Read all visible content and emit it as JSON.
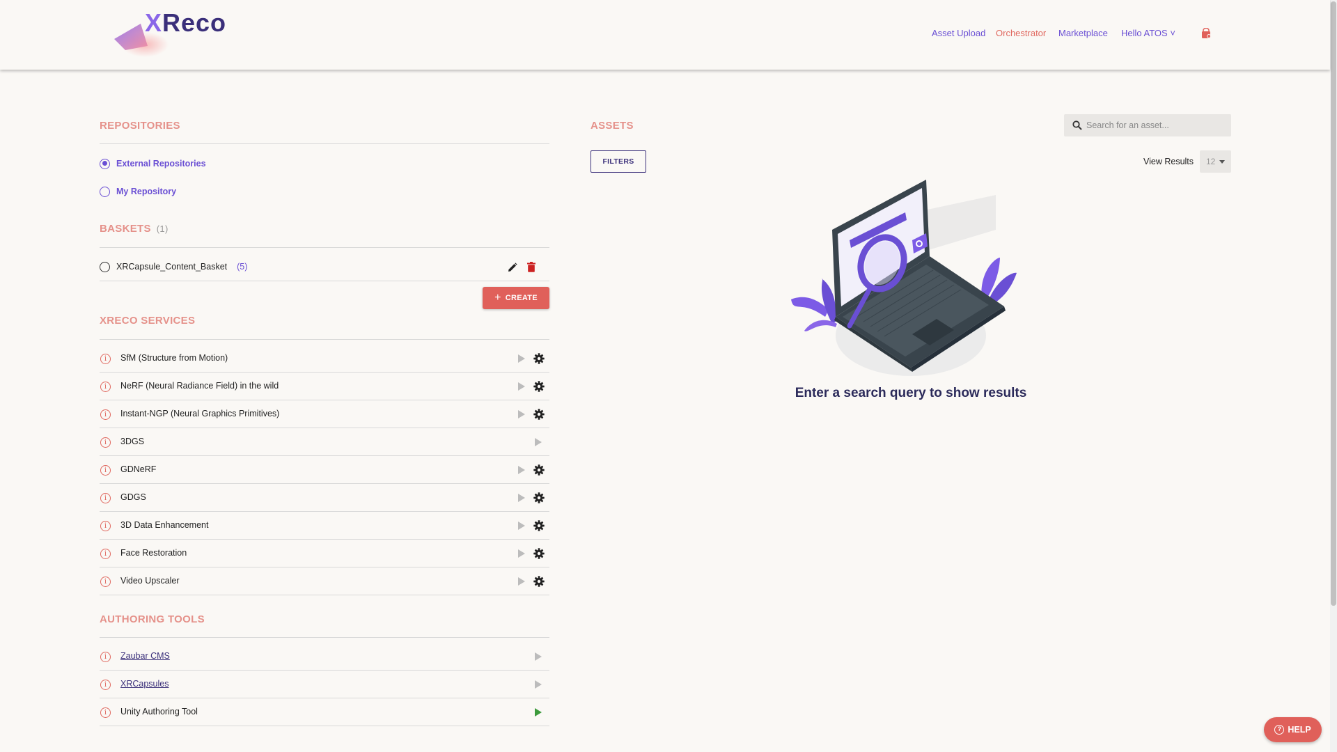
{
  "header": {
    "logo_text_x": "X",
    "logo_text_rest": "Reco",
    "nav": [
      {
        "label": "Asset Upload",
        "active": false
      },
      {
        "label": "Orchestrator",
        "active": true
      },
      {
        "label": "Marketplace",
        "active": false
      }
    ],
    "user_menu": "Hello ATOS ˅",
    "basket_icon": "basket-icon"
  },
  "repositories": {
    "title": "REPOSITORIES",
    "options": [
      {
        "label": "External Repositories",
        "checked": true
      },
      {
        "label": "My Repository",
        "checked": false
      }
    ]
  },
  "baskets": {
    "title": "BASKETS",
    "count": "(1)",
    "items": [
      {
        "label": "XRCapsule_Content_Basket",
        "count": "(5)"
      }
    ],
    "create_label": "CREATE"
  },
  "services": {
    "title": "XRECO SERVICES",
    "items": [
      {
        "label": "SfM (Structure from Motion)",
        "has_settings": true
      },
      {
        "label": "NeRF (Neural Radiance Field) in the wild",
        "has_settings": true
      },
      {
        "label": "Instant-NGP (Neural Graphics Primitives)",
        "has_settings": true
      },
      {
        "label": "3DGS",
        "has_settings": false
      },
      {
        "label": "GDNeRF",
        "has_settings": true
      },
      {
        "label": "GDGS",
        "has_settings": true
      },
      {
        "label": "3D Data Enhancement",
        "has_settings": true
      },
      {
        "label": "Face Restoration",
        "has_settings": true
      },
      {
        "label": "Video Upscaler",
        "has_settings": true
      }
    ]
  },
  "authoring": {
    "title": "AUTHORING TOOLS",
    "items": [
      {
        "label": "Zaubar CMS",
        "link": true,
        "play_color": "#bcbcbc"
      },
      {
        "label": "XRCapsules",
        "link": true,
        "play_color": "#bcbcbc"
      },
      {
        "label": "Unity Authoring Tool",
        "link": false,
        "play_color": "#3c9a3c"
      }
    ]
  },
  "assets": {
    "title": "ASSETS",
    "search_placeholder": "Search for an asset...",
    "filters_label": "FILTERS",
    "view_results_label": "View Results",
    "view_results_value": "12",
    "empty_message": "Enter a search query to show results"
  },
  "help": {
    "label": "HELP"
  },
  "colors": {
    "accent_purple": "#6a4fd4",
    "accent_red": "#e0605a",
    "section_title": "#e5918a",
    "background": "#faf8f5"
  }
}
